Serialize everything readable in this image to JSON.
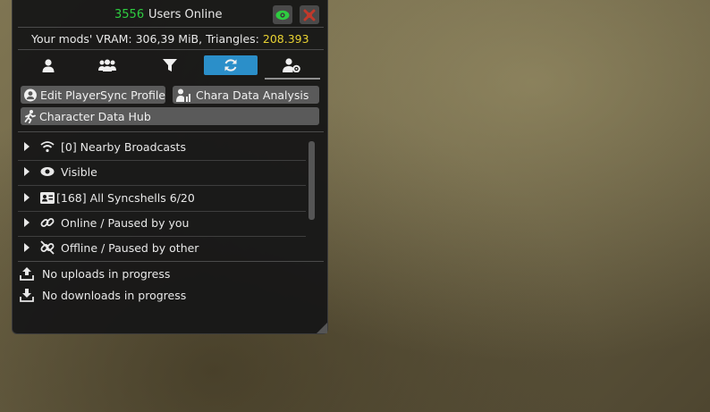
{
  "header": {
    "users_online_count": "3556",
    "users_online_label": "Users Online"
  },
  "vram": {
    "prefix": "Your mods' VRAM: 306,39 MiB, Triangles: ",
    "triangles": "208.393"
  },
  "tabs": [
    {
      "icon": "user-icon"
    },
    {
      "icon": "users-icon"
    },
    {
      "icon": "filter-icon"
    },
    {
      "icon": "refresh-icon",
      "active": true
    },
    {
      "icon": "user-settings-icon"
    }
  ],
  "buttons": {
    "edit_profile": "Edit PlayerSync Profile",
    "chara_analysis": "Chara Data Analysis",
    "character_hub": "Character Data Hub"
  },
  "groups": [
    {
      "icon": "wifi-icon",
      "label": "[0] Nearby Broadcasts"
    },
    {
      "icon": "eye-icon",
      "label": "Visible"
    },
    {
      "icon": "id-card-icon",
      "label": "[168]  All Syncshells 6/20"
    },
    {
      "icon": "link-icon",
      "label": "Online / Paused by you"
    },
    {
      "icon": "unlink-icon",
      "label": "Offline / Paused by other"
    }
  ],
  "transfers": {
    "uploads": "No uploads in progress",
    "downloads": "No downloads in progress"
  },
  "colors": {
    "online_green": "#2ecc40",
    "triangles_yellow": "#e8d232",
    "active_tab_blue": "#2b8fc9",
    "disconnect_red": "#c0392b"
  }
}
